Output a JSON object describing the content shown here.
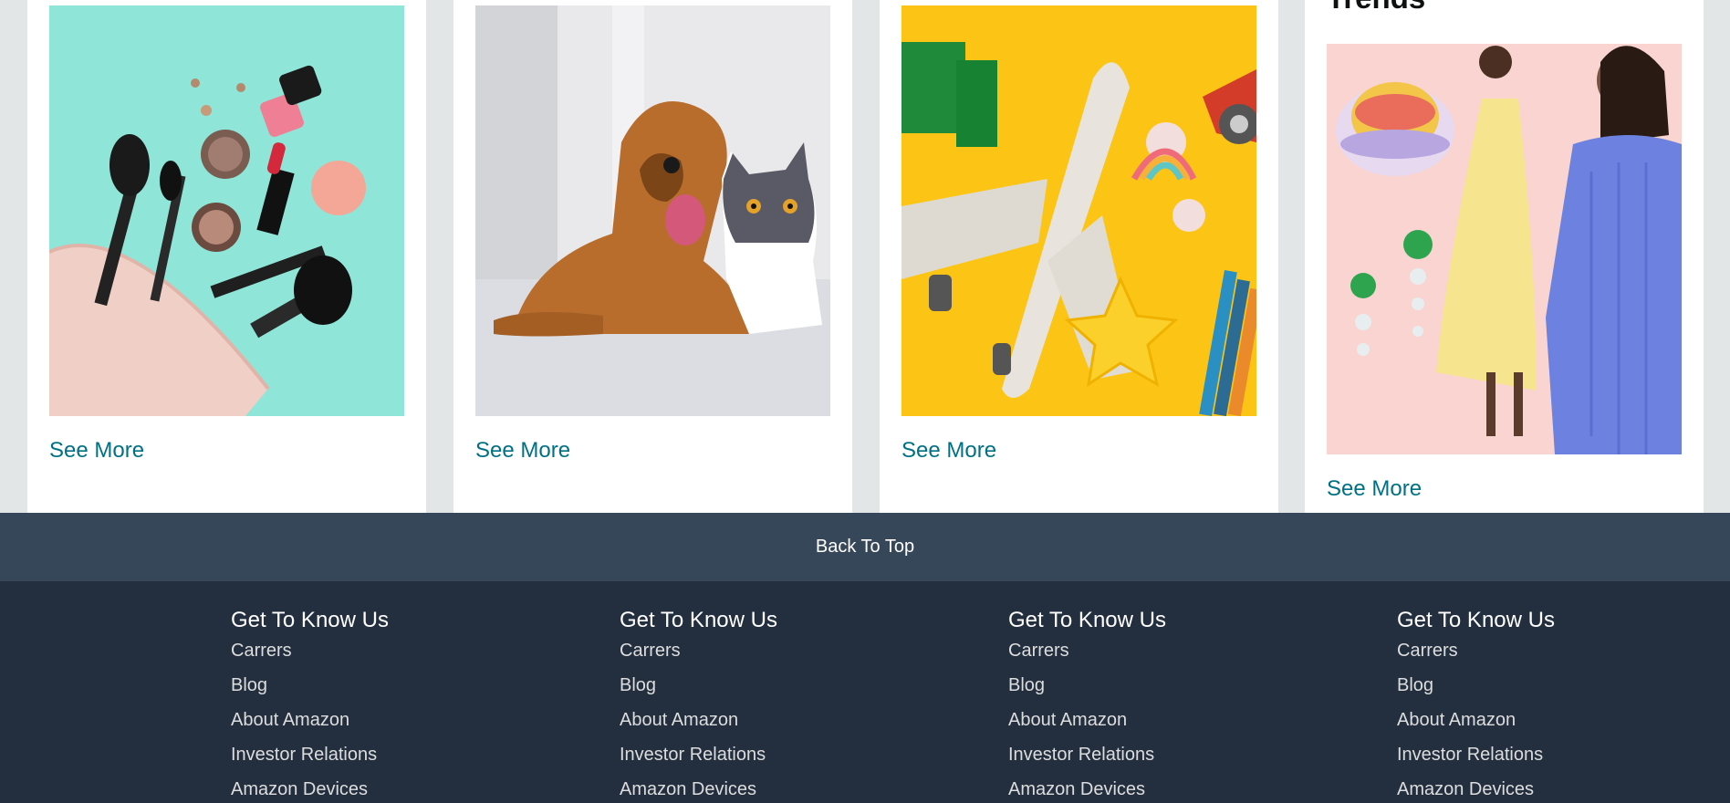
{
  "cards": [
    {
      "title": "",
      "image_name": "beauty-products-image",
      "see_more": "See More"
    },
    {
      "title": "",
      "image_name": "pets-image",
      "see_more": "See More"
    },
    {
      "title": "",
      "image_name": "toys-image",
      "see_more": "See More"
    },
    {
      "title": "Trends",
      "image_name": "fashion-trends-image",
      "see_more": "See More"
    }
  ],
  "back_to_top": "Back To Top",
  "footer": {
    "columns": [
      {
        "heading": "Get To Know Us",
        "links": [
          "Carrers",
          "Blog",
          "About Amazon",
          "Investor Relations",
          "Amazon Devices"
        ]
      },
      {
        "heading": "Get To Know Us",
        "links": [
          "Carrers",
          "Blog",
          "About Amazon",
          "Investor Relations",
          "Amazon Devices"
        ]
      },
      {
        "heading": "Get To Know Us",
        "links": [
          "Carrers",
          "Blog",
          "About Amazon",
          "Investor Relations",
          "Amazon Devices"
        ]
      },
      {
        "heading": "Get To Know Us",
        "links": [
          "Carrers",
          "Blog",
          "About Amazon",
          "Investor Relations",
          "Amazon Devices"
        ]
      }
    ]
  },
  "colors": {
    "page_bg": "#e3e6e6",
    "link": "#007185",
    "back_to_top_bg": "#37475a",
    "footer_bg": "#232f3e"
  }
}
